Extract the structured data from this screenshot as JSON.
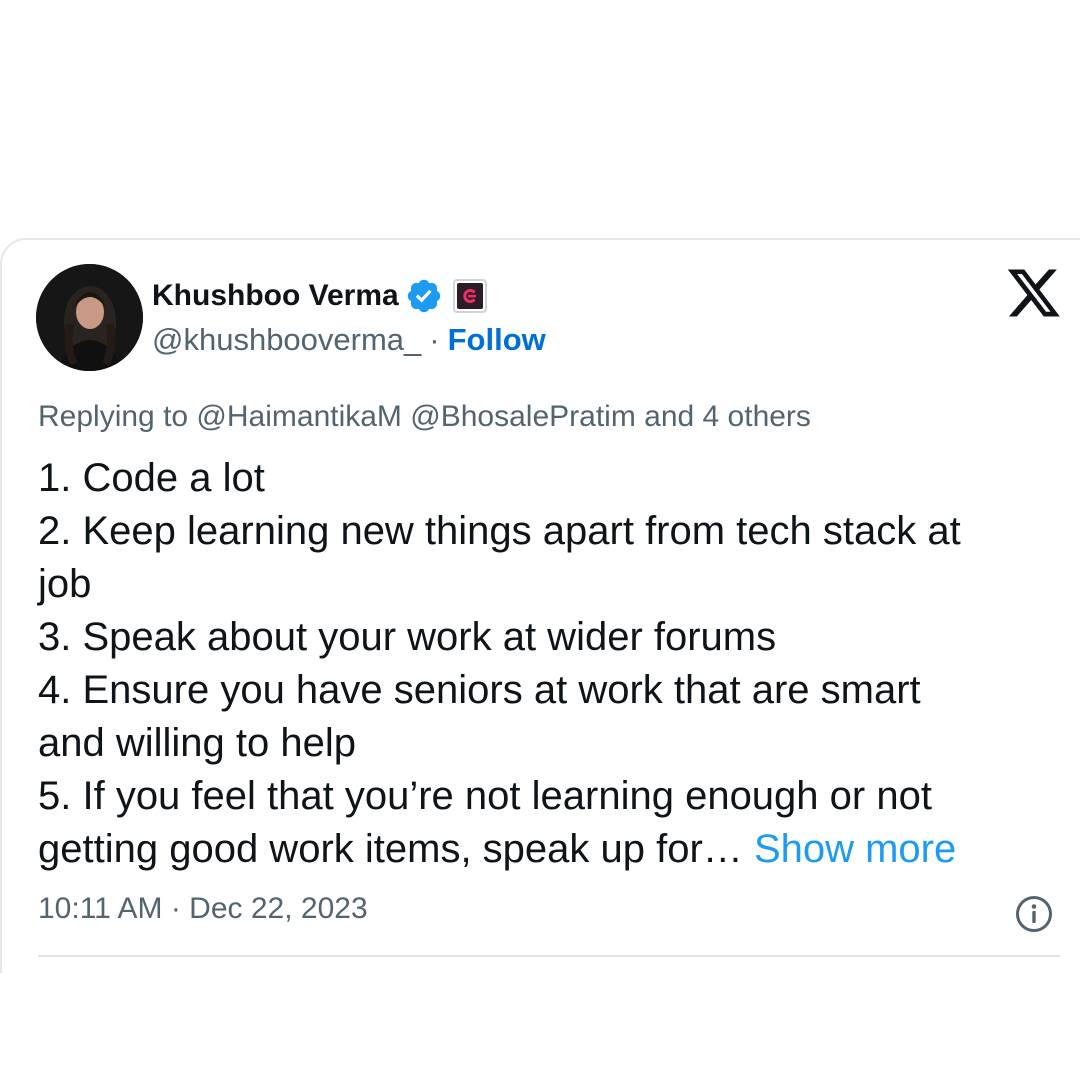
{
  "tweet": {
    "author": {
      "display_name": "Khushboo Verma",
      "handle": "@khushbooverma_",
      "separator": "·",
      "follow_label": "Follow",
      "verified_icon": "verified-badge-icon",
      "affiliate_icon": "affiliate-badge-icon",
      "avatar_icon": "profile-photo"
    },
    "platform_icon": "x-logo-icon",
    "replying_to": "Replying to @HaimantikaM @BhosalePratim and 4 others",
    "body_lines": [
      "1. Code a lot",
      "2. Keep learning new things apart from tech stack at",
      "job",
      "3. Speak about your work at wider forums",
      "4. Ensure you have seniors at work that are smart",
      "and willing to help",
      "5. If you feel that you’re not learning enough or not",
      "getting good work items, speak up for…"
    ],
    "show_more_label": "Show more",
    "timestamp": "10:11 AM · Dec 22, 2023",
    "info_icon": "info-icon"
  },
  "colors": {
    "text_primary": "#0f1419",
    "text_secondary": "#536471",
    "follow_blue": "#006fd6",
    "link_blue": "#1d9bf0",
    "verified_blue": "#1d9bf0",
    "affiliate_bg": "#2b1c27",
    "affiliate_accent": "#f02e65",
    "border": "#e3e7ea"
  }
}
